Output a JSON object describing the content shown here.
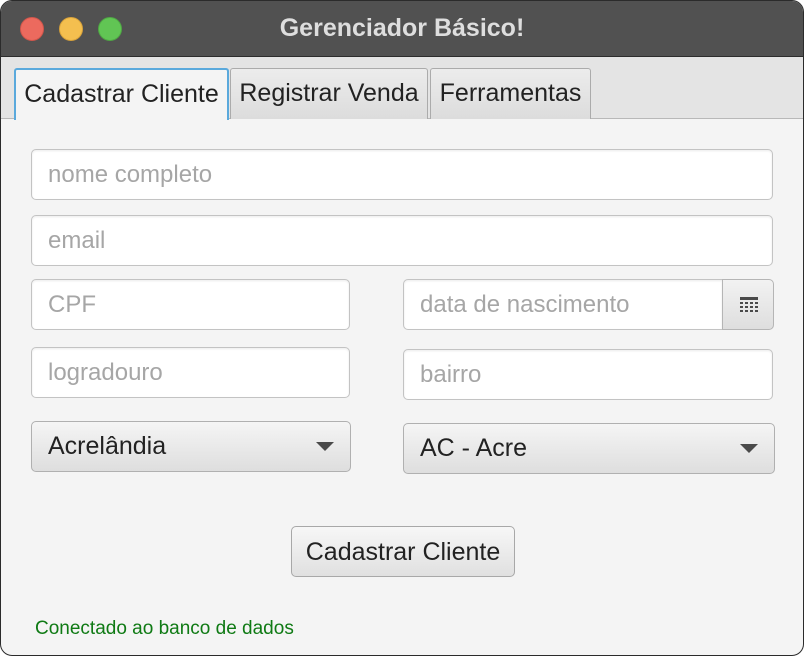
{
  "window": {
    "title": "Gerenciador Básico!"
  },
  "tabs": [
    {
      "label": "Cadastrar Cliente",
      "active": true
    },
    {
      "label": "Registrar Venda",
      "active": false
    },
    {
      "label": "Ferramentas",
      "active": false
    }
  ],
  "form": {
    "nome": {
      "placeholder": "nome completo",
      "value": ""
    },
    "email": {
      "placeholder": "email",
      "value": ""
    },
    "cpf": {
      "placeholder": "CPF",
      "value": ""
    },
    "data_nascimento": {
      "placeholder": "data de nascimento",
      "value": "",
      "icon": "calendar-icon"
    },
    "logradouro": {
      "placeholder": "logradouro",
      "value": ""
    },
    "bairro": {
      "placeholder": "bairro",
      "value": ""
    },
    "cidade": {
      "selected": "Acrelândia"
    },
    "estado": {
      "selected": "AC - Acre"
    },
    "submit_label": "Cadastrar Cliente"
  },
  "status": {
    "text": "Conectado ao banco de dados",
    "color": "#0f7a14"
  }
}
